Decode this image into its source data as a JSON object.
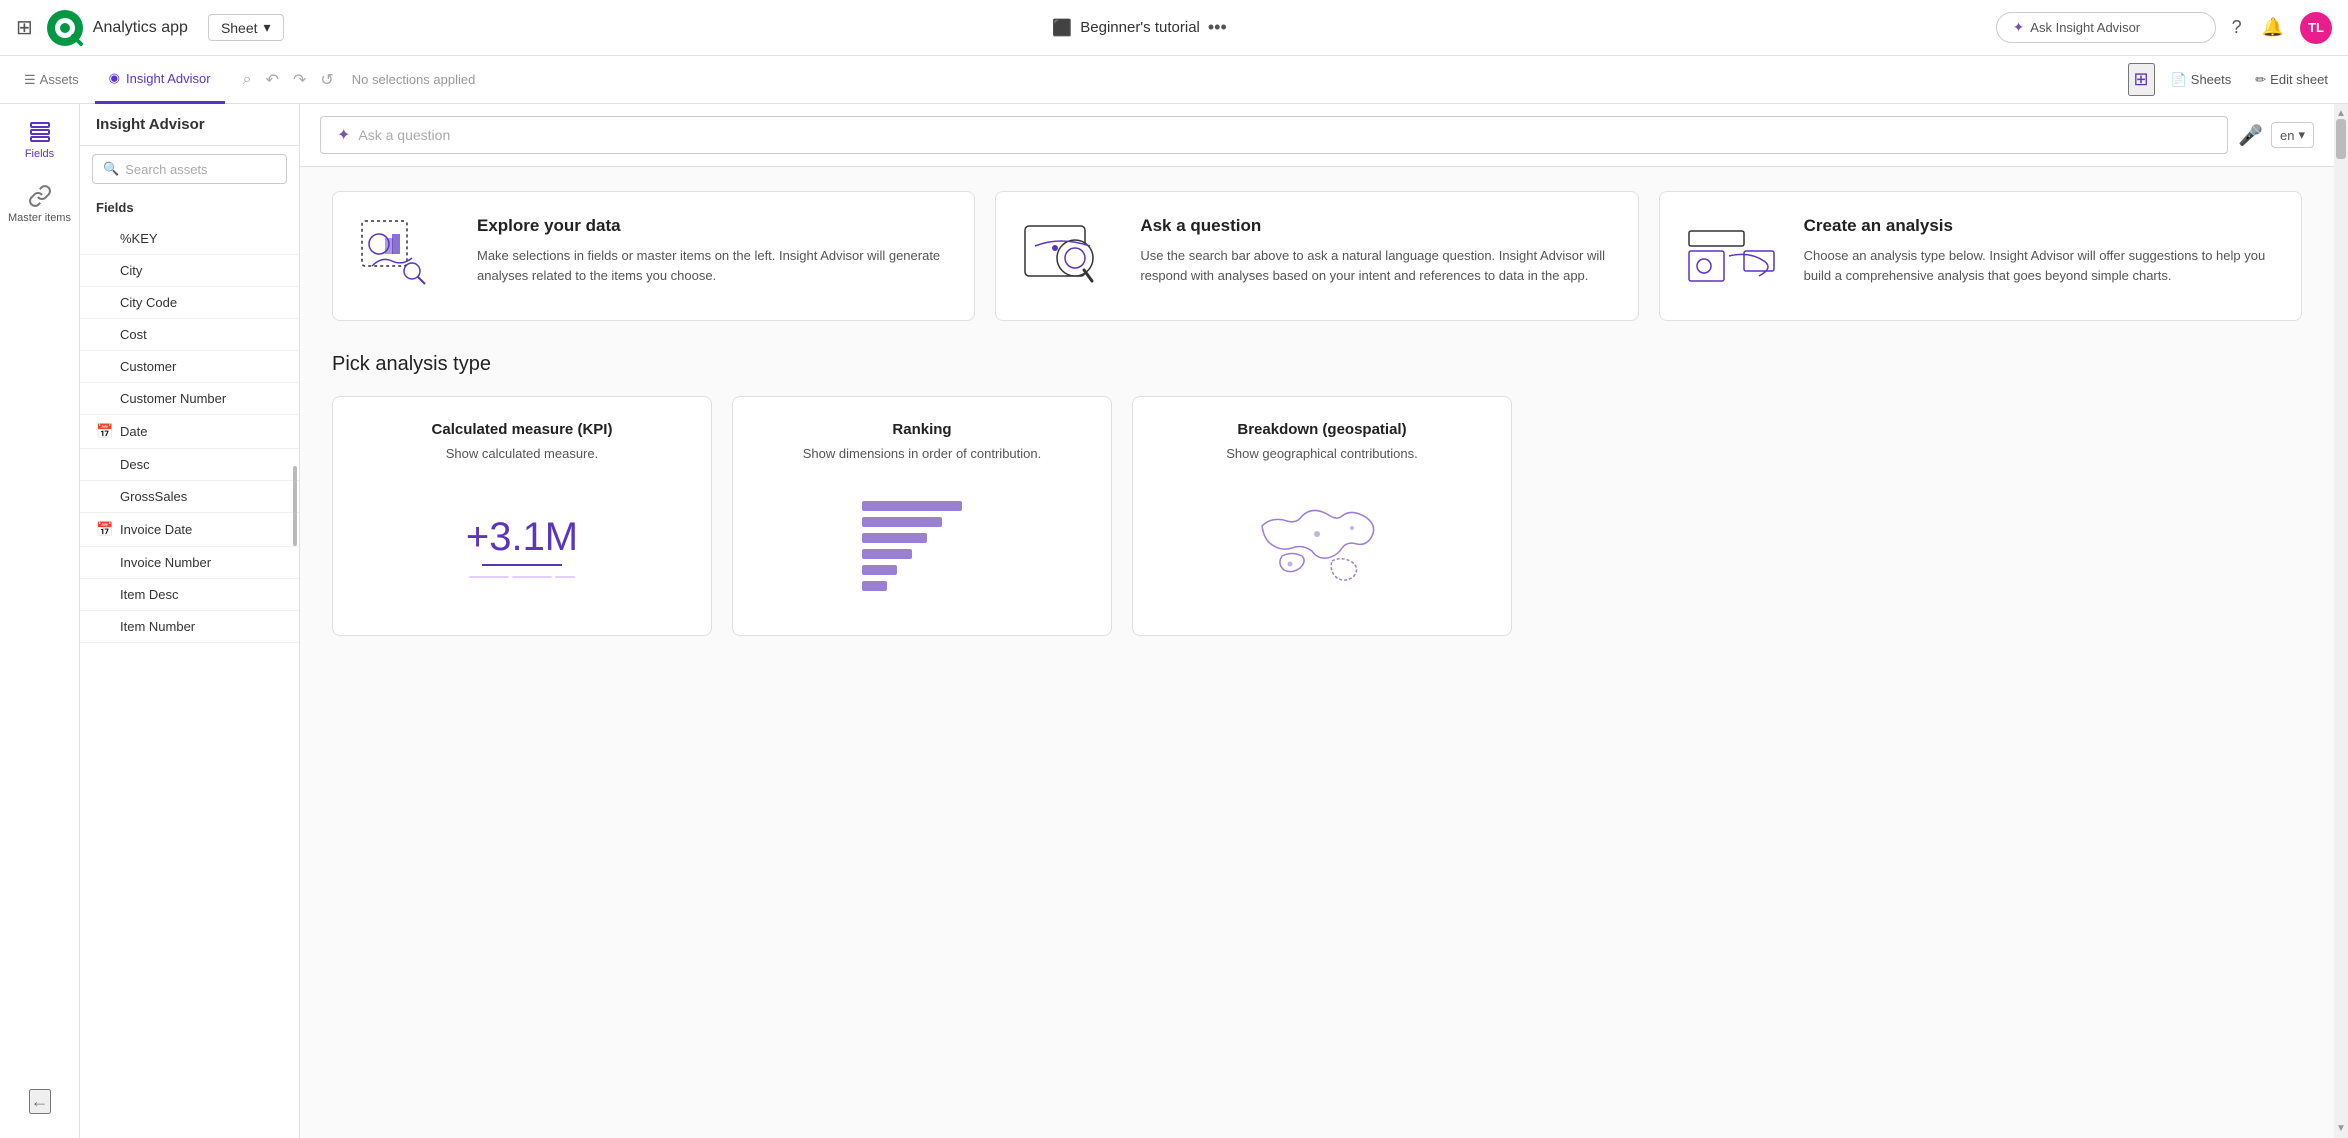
{
  "topNav": {
    "appName": "Analytics app",
    "sheetDropdown": "Sheet",
    "tutorialLabel": "Beginner's tutorial",
    "askInsightPlaceholder": "Ask Insight Advisor",
    "avatarInitials": "TL"
  },
  "secondaryNav": {
    "assetsLabel": "Assets",
    "insightAdvisorLabel": "Insight Advisor",
    "noSelections": "No selections applied",
    "sheetsLabel": "Sheets",
    "editSheetLabel": "Edit sheet"
  },
  "sidebar": {
    "fieldsLabel": "Fields",
    "masterItemsLabel": "Master items"
  },
  "fieldsPanel": {
    "title": "Insight Advisor",
    "searchPlaceholder": "Search assets",
    "fieldsGroupLabel": "Fields",
    "fields": [
      {
        "name": "%KEY",
        "hasIcon": false
      },
      {
        "name": "City",
        "hasIcon": false
      },
      {
        "name": "City Code",
        "hasIcon": false
      },
      {
        "name": "Cost",
        "hasIcon": false
      },
      {
        "name": "Customer",
        "hasIcon": false
      },
      {
        "name": "Customer Number",
        "hasIcon": false
      },
      {
        "name": "Date",
        "hasIcon": true
      },
      {
        "name": "Desc",
        "hasIcon": false
      },
      {
        "name": "GrossSales",
        "hasIcon": false
      },
      {
        "name": "Invoice Date",
        "hasIcon": true
      },
      {
        "name": "Invoice Number",
        "hasIcon": false
      },
      {
        "name": "Item Desc",
        "hasIcon": false
      },
      {
        "name": "Item Number",
        "hasIcon": false
      }
    ]
  },
  "askBar": {
    "placeholder": "Ask a question",
    "langLabel": "en"
  },
  "infoCards": [
    {
      "title": "Explore your data",
      "description": "Make selections in fields or master items on the left. Insight Advisor will generate analyses related to the items you choose."
    },
    {
      "title": "Ask a question",
      "description": "Use the search bar above to ask a natural language question. Insight Advisor will respond with analyses based on your intent and references to data in the app."
    },
    {
      "title": "Create an analysis",
      "description": "Choose an analysis type below. Insight Advisor will offer suggestions to help you build a comprehensive analysis that goes beyond simple charts."
    }
  ],
  "analysisSection": {
    "title": "Pick analysis type",
    "cards": [
      {
        "title": "Calculated measure (KPI)",
        "description": "Show calculated measure.",
        "kpiValue": "+3.1M"
      },
      {
        "title": "Ranking",
        "description": "Show dimensions in order of contribution."
      },
      {
        "title": "Breakdown (geospatial)",
        "description": "Show geographical contributions."
      }
    ]
  }
}
